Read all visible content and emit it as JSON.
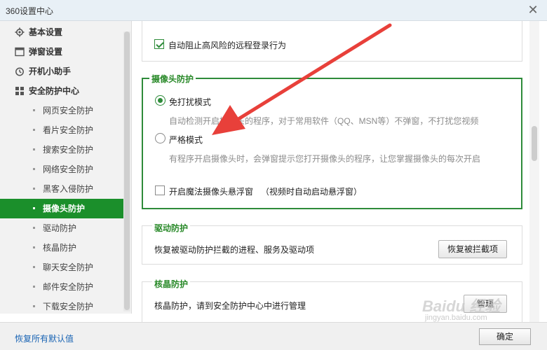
{
  "window": {
    "title": "360设置中心",
    "close_symbol": "✕"
  },
  "sidebar": {
    "items": [
      {
        "label": "基本设置",
        "icon": "gear-icon",
        "level": "top"
      },
      {
        "label": "弹窗设置",
        "icon": "window-icon",
        "level": "top"
      },
      {
        "label": "开机小助手",
        "icon": "power-clock-icon",
        "level": "top"
      },
      {
        "label": "安全防护中心",
        "icon": "shield-grid-icon",
        "level": "top"
      },
      {
        "label": "网页安全防护",
        "level": "sub"
      },
      {
        "label": "看片安全防护",
        "level": "sub"
      },
      {
        "label": "搜索安全防护",
        "level": "sub"
      },
      {
        "label": "网络安全防护",
        "level": "sub"
      },
      {
        "label": "黑客入侵防护",
        "level": "sub"
      },
      {
        "label": "摄像头防护",
        "level": "sub",
        "active": true
      },
      {
        "label": "驱动防护",
        "level": "sub"
      },
      {
        "label": "核晶防护",
        "level": "sub"
      },
      {
        "label": "聊天安全防护",
        "level": "sub"
      },
      {
        "label": "邮件安全防护",
        "level": "sub"
      },
      {
        "label": "下载安全防护",
        "level": "sub"
      }
    ]
  },
  "main": {
    "remote_section": {
      "checkbox_label": "自动阻止高风险的远程登录行为",
      "checked": true
    },
    "camera_section": {
      "title": "摄像头防护",
      "option1_label": "免打扰模式",
      "option1_desc": "自动检测开启摄像头的程序，对于常用软件（QQ、MSN等）不弹窗，不打扰您视频",
      "option2_label": "严格模式",
      "option2_desc": "有程序开启摄像头时，会弹窗提示您打开摄像头的程序，让您掌握摄像头的每次开启",
      "float_checkbox_label": "开启魔法摄像头悬浮窗",
      "float_checkbox_note": "（视频时自动启动悬浮窗）",
      "selected_option": "免打扰模式"
    },
    "driver_section": {
      "title": "驱动防护",
      "desc": "恢复被驱动防护拦截的进程、服务及驱动项",
      "button": "恢复被拦截项"
    },
    "core_section": {
      "title": "核晶防护",
      "desc": "核晶防护，请到安全防护中心中进行管理",
      "button": "管理"
    }
  },
  "footer": {
    "restore_link": "恢复所有默认值",
    "ok_button": "确定"
  },
  "watermark": {
    "brand": "Baidu 经验",
    "url": "jingyan.baidu.com"
  },
  "colors": {
    "accent_green": "#1b8f2b",
    "highlight_border": "#2e8b3a",
    "arrow_red": "#e8403a",
    "link_blue": "#1a64b4"
  }
}
